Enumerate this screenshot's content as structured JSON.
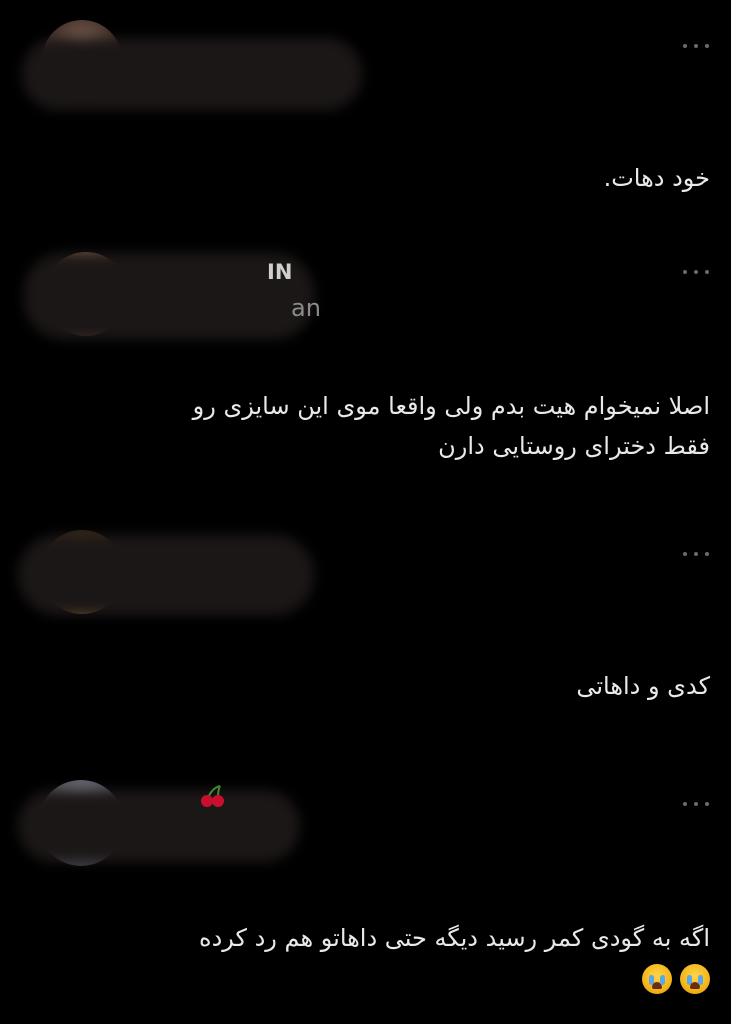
{
  "comments": [
    {
      "text_lines": [
        "خود دهات."
      ],
      "more_label": "...",
      "emojis": []
    },
    {
      "text_lines": [
        "اصلا نمیخوام هیت بدم ولی واقعا موی این سایزی رو",
        "فقط دخترای روستایی دارن"
      ],
      "more_label": "...",
      "visible_name_fragment": "IN",
      "visible_handle_fragment": "an",
      "emojis": []
    },
    {
      "text_lines": [
        "کدی و داهاتی"
      ],
      "more_label": "...",
      "emojis": []
    },
    {
      "text_lines": [
        "اگه به گودی کمر رسید دیگه حتی داهاتو هم رد کرده"
      ],
      "more_label": "...",
      "emojis": [
        "loudly-crying-face-icon",
        "loudly-crying-face-icon"
      ]
    }
  ],
  "colors": {
    "background": "#000000",
    "text": "#e7e9ea",
    "more_dots": "#6b6b6b",
    "redaction": "#1c1717"
  }
}
